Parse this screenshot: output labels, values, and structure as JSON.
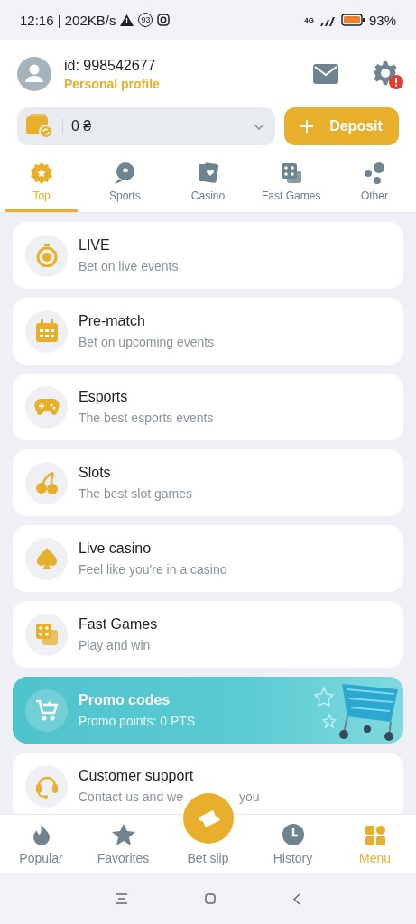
{
  "status_bar": {
    "time": "12:16 | 202KB/s",
    "notification_count": "93",
    "network": "4G",
    "battery": "93%"
  },
  "profile": {
    "user_id": "id: 998542677",
    "link": "Personal profile",
    "settings_alert": true
  },
  "balance": {
    "amount": "0 ₴"
  },
  "deposit_button": "Deposit",
  "tabs": [
    {
      "label": "Top",
      "selected": true
    },
    {
      "label": "Sports",
      "selected": false
    },
    {
      "label": "Casino",
      "selected": false
    },
    {
      "label": "Fast Games",
      "selected": false
    },
    {
      "label": "Other",
      "selected": false
    }
  ],
  "menu": [
    {
      "kind": "item",
      "title": "LIVE",
      "subtitle": "Bet on live events"
    },
    {
      "kind": "item",
      "title": "Pre-match",
      "subtitle": "Bet on upcoming events"
    },
    {
      "kind": "item",
      "title": "Esports",
      "subtitle": "The best esports events"
    },
    {
      "kind": "item",
      "title": "Slots",
      "subtitle": "The best slot games"
    },
    {
      "kind": "item",
      "title": "Live casino",
      "subtitle": "Feel like you're in a casino"
    },
    {
      "kind": "item",
      "title": "Fast Games",
      "subtitle": "Play and win"
    },
    {
      "kind": "promo",
      "title": "Promo codes",
      "subtitle": "Promo points: 0 PTS"
    },
    {
      "kind": "item",
      "title": "Customer support",
      "subtitle": "Contact us and we",
      "subtitle_end": "you"
    }
  ],
  "bottom_nav": [
    {
      "label": "Popular",
      "kind": "tab",
      "selected": false
    },
    {
      "label": "Favorites",
      "kind": "tab",
      "selected": false
    },
    {
      "label": "Bet slip",
      "kind": "center",
      "selected": false
    },
    {
      "label": "History",
      "kind": "tab",
      "selected": false
    },
    {
      "label": "Menu",
      "kind": "tab",
      "selected": true
    }
  ]
}
